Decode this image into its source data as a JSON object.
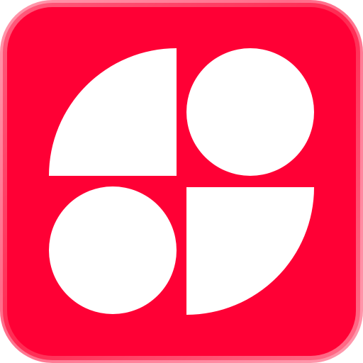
{
  "icon": {
    "name": "app-icon",
    "shape": "rounded-square",
    "background_color": "#FF0035",
    "edge_highlight_color": "#FF7C96",
    "glyph_color": "#FFFFFF",
    "glyph": {
      "top_left": "quarter-circle",
      "top_right": "circle",
      "bottom_left": "circle",
      "bottom_right": "quarter-circle"
    }
  }
}
